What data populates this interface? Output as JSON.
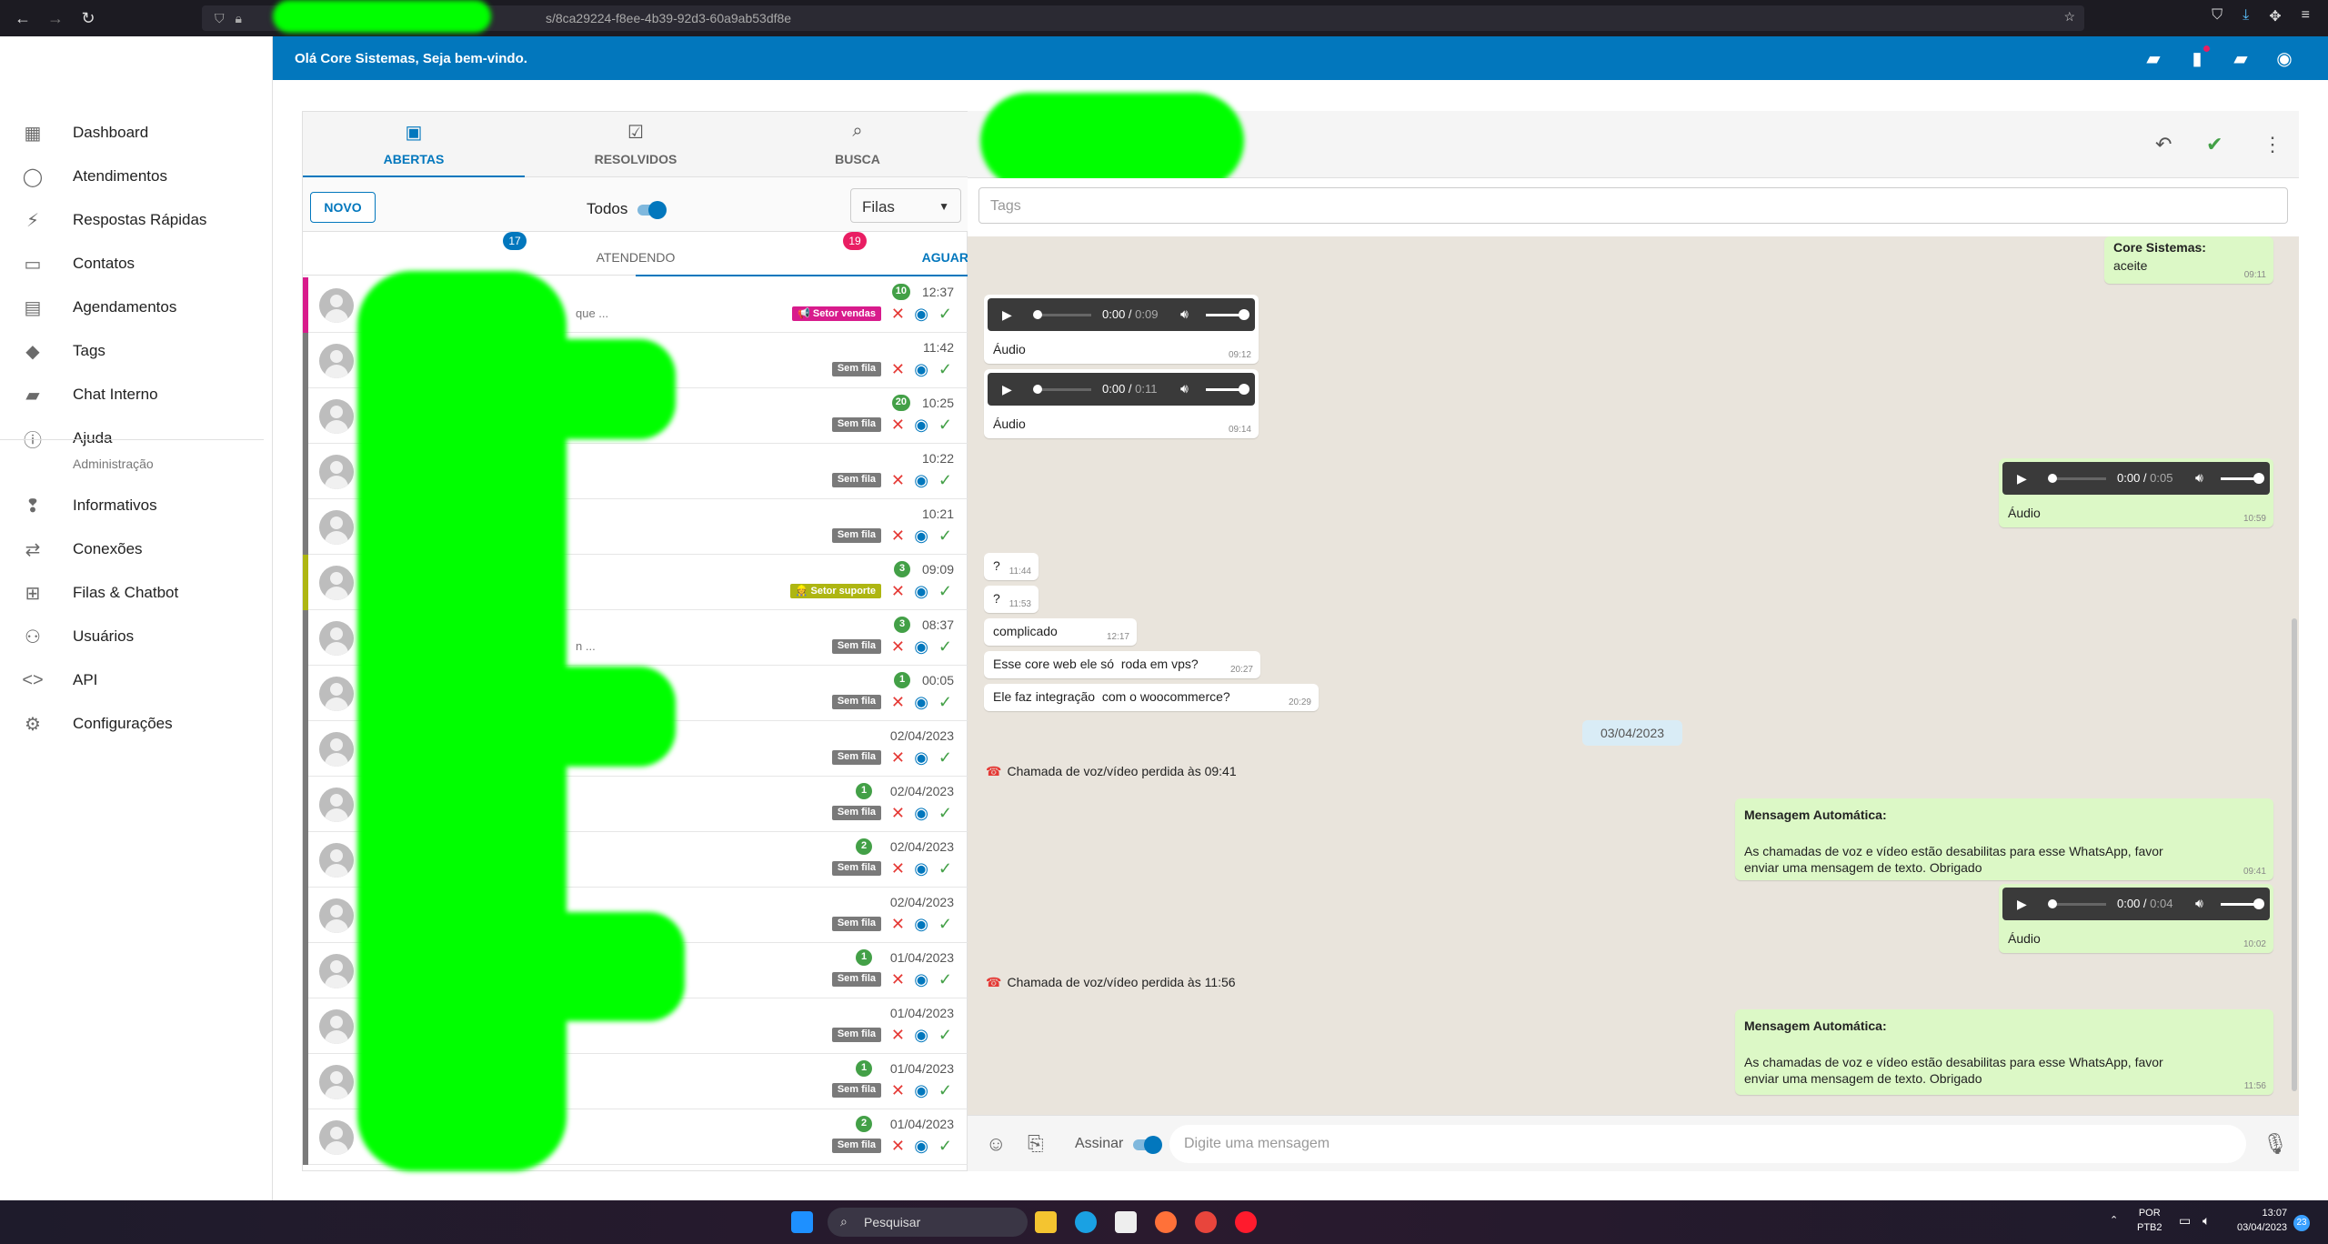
{
  "browser": {
    "url": "s/8ca29224-f8ee-4b39-92d3-60a9ab53df8e"
  },
  "topbar": {
    "greeting": "Olá Core Sistemas, Seja bem-vindo."
  },
  "sidebar": {
    "items": [
      {
        "label": "Dashboard",
        "icon": "dashboard-icon"
      },
      {
        "label": "Atendimentos",
        "icon": "whatsapp-icon"
      },
      {
        "label": "Respostas Rápidas",
        "icon": "bolt-icon"
      },
      {
        "label": "Contatos",
        "icon": "contacts-icon"
      },
      {
        "label": "Agendamentos",
        "icon": "calendar-icon"
      },
      {
        "label": "Tags",
        "icon": "tag-icon"
      },
      {
        "label": "Chat Interno",
        "icon": "forum-icon"
      },
      {
        "label": "Ajuda",
        "icon": "help-icon"
      }
    ],
    "section_label": "Administração",
    "admin_items": [
      {
        "label": "Informativos",
        "icon": "announcement-icon"
      },
      {
        "label": "Conexões",
        "icon": "sync-arrows-icon"
      },
      {
        "label": "Filas & Chatbot",
        "icon": "account-tree-icon"
      },
      {
        "label": "Usuários",
        "icon": "people-icon"
      },
      {
        "label": "API",
        "icon": "code-icon"
      },
      {
        "label": "Configurações",
        "icon": "settings-icon"
      }
    ]
  },
  "tickets": {
    "tabs": [
      {
        "label": "ABERTAS",
        "icon": "inbox-icon",
        "active": true
      },
      {
        "label": "RESOLVIDOS",
        "icon": "checkbox-icon",
        "active": false
      },
      {
        "label": "BUSCA",
        "icon": "search-icon",
        "active": false
      }
    ],
    "new_button": "NOVO",
    "show_all_label": "Todos",
    "queue_select": "Filas",
    "subtabs": [
      {
        "label": "ATENDENDO",
        "badge": "17",
        "badge_color": "#0277bd"
      },
      {
        "label": "AGUARDANDO",
        "badge": "19",
        "badge_color": "#e91e63"
      }
    ],
    "rows": [
      {
        "time": "12:37",
        "count": "10",
        "queue": "📢 Setor vendas",
        "queue_color": "#d81b8c",
        "bar": "#d81b8c",
        "preview": "que ..."
      },
      {
        "time": "11:42",
        "count": "",
        "queue": "Sem fila",
        "queue_color": "#7a7a7a",
        "bar": "#7a7a7a",
        "preview": ""
      },
      {
        "time": "10:25",
        "count": "20",
        "queue": "Sem fila",
        "queue_color": "#7a7a7a",
        "bar": "#7a7a7a",
        "preview": ""
      },
      {
        "time": "10:22",
        "count": "",
        "queue": "Sem fila",
        "queue_color": "#7a7a7a",
        "bar": "#7a7a7a",
        "preview": ""
      },
      {
        "time": "10:21",
        "count": "",
        "queue": "Sem fila",
        "queue_color": "#7a7a7a",
        "bar": "#7a7a7a",
        "preview": ""
      },
      {
        "time": "09:09",
        "count": "3",
        "queue": "👷 Setor suporte",
        "queue_color": "#aeb612",
        "bar": "#aeb612",
        "preview": ""
      },
      {
        "time": "08:37",
        "count": "3",
        "queue": "Sem fila",
        "queue_color": "#7a7a7a",
        "bar": "#7a7a7a",
        "preview": "n ..."
      },
      {
        "time": "00:05",
        "count": "1",
        "queue": "Sem fila",
        "queue_color": "#7a7a7a",
        "bar": "#7a7a7a",
        "preview": ""
      },
      {
        "time": "02/04/2023",
        "count": "",
        "queue": "Sem fila",
        "queue_color": "#7a7a7a",
        "bar": "#7a7a7a",
        "preview": ""
      },
      {
        "time": "02/04/2023",
        "count": "1",
        "queue": "Sem fila",
        "queue_color": "#7a7a7a",
        "bar": "#7a7a7a",
        "preview": ""
      },
      {
        "time": "02/04/2023",
        "count": "2",
        "queue": "Sem fila",
        "queue_color": "#7a7a7a",
        "bar": "#7a7a7a",
        "preview": ""
      },
      {
        "time": "02/04/2023",
        "count": "",
        "queue": "Sem fila",
        "queue_color": "#7a7a7a",
        "bar": "#7a7a7a",
        "preview": ""
      },
      {
        "time": "01/04/2023",
        "count": "1",
        "queue": "Sem fila",
        "queue_color": "#7a7a7a",
        "bar": "#7a7a7a",
        "preview": ""
      },
      {
        "time": "01/04/2023",
        "count": "",
        "queue": "Sem fila",
        "queue_color": "#7a7a7a",
        "bar": "#7a7a7a",
        "preview": ""
      },
      {
        "time": "01/04/2023",
        "count": "1",
        "queue": "Sem fila",
        "queue_color": "#7a7a7a",
        "bar": "#7a7a7a",
        "preview": ""
      },
      {
        "time": "01/04/2023",
        "count": "2",
        "queue": "Sem fila",
        "queue_color": "#7a7a7a",
        "bar": "#7a7a7a",
        "preview": ""
      }
    ]
  },
  "chat": {
    "tags_placeholder": "Tags",
    "messages": {
      "m1_sender": "Core Sistemas:",
      "m1_text": "aceite",
      "m1_time": "09:11",
      "a1_time_cur": "0:00",
      "a1_time_dur": "0:09",
      "a1_label": "Áudio",
      "a1_time": "09:12",
      "a2_time_cur": "0:00",
      "a2_time_dur": "0:11",
      "a2_label": "Áudio",
      "a2_time": "09:14",
      "a3_time_cur": "0:00",
      "a3_time_dur": "0:05",
      "a3_label": "Áudio",
      "a3_time": "10:59",
      "q1_text": "?",
      "q1_time": "11:44",
      "q2_text": "?",
      "q2_time": "11:53",
      "c_text": "complicado",
      "c_time": "12:17",
      "v_text": "Esse core web ele só  roda em vps?",
      "v_time": "20:27",
      "w_text": "Ele faz integração  com o woocommerce?",
      "w_time": "20:29",
      "date_chip": "03/04/2023",
      "call1": "Chamada de voz/vídeo perdida às 09:41",
      "auto1_title": "Mensagem Automática:",
      "auto1_line1": "As chamadas de voz e vídeo estão desabilitas para esse WhatsApp, favor",
      "auto1_line2": "enviar uma mensagem de texto. Obrigado",
      "auto1_time": "09:41",
      "a4_time_cur": "0:00",
      "a4_time_dur": "0:04",
      "a4_label": "Áudio",
      "a4_time": "10:02",
      "call2": "Chamada de voz/vídeo perdida às 11:56",
      "auto2_title": "Mensagem Automática:",
      "auto2_line1": "As chamadas de voz e vídeo estão desabilitas para esse WhatsApp, favor",
      "auto2_line2": "enviar uma mensagem de texto. Obrigado",
      "auto2_time": "11:56"
    },
    "composer": {
      "sign_label": "Assinar",
      "placeholder": "Digite uma mensagem"
    }
  },
  "taskbar": {
    "search": "Pesquisar",
    "lang1": "POR",
    "lang2": "PTB2",
    "time": "13:07",
    "date": "03/04/2023",
    "notif": "23"
  }
}
